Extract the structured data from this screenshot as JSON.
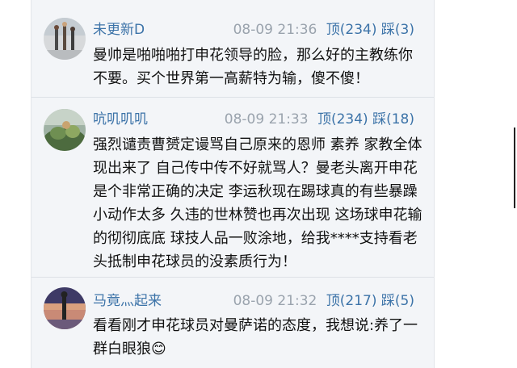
{
  "comments": [
    {
      "username": "未更新D",
      "time": "08-09 21:36",
      "up_label": "顶(234)",
      "down_label": "踩(3)",
      "text": "曼帅是啪啪啪打申花领导的脸，那么好的主教练你不要。买个世界第一高薪特为输，傻不傻！"
    },
    {
      "username": "吭叽叽叽",
      "time": "08-09 21:33",
      "up_label": "顶(234)",
      "down_label": "踩(18)",
      "text": "强烈谴责曹赟定谩骂自己原来的恩师 素养 家教全体现出来了 自己传中传不好就骂人？曼老头离开申花是个非常正确的决定 李运秋现在踢球真的有些暴躁小动作太多 久违的世林赞也再次出现 这场球申花输的彻彻底底 球技人品一败涂地，给我****支持看老头抵制申花球员的没素质行为！"
    },
    {
      "username": "马竟灬起来",
      "time": "08-09 21:32",
      "up_label": "顶(217)",
      "down_label": "踩(5)",
      "text": "看看刚才申花球员对曼萨诺的态度，我想说:养了一群白眼狼😊"
    }
  ],
  "colors": {
    "link": "#3c73a8",
    "meta": "#9aa3ad",
    "panel_bg": "#f3f5f8",
    "text": "#111111"
  }
}
